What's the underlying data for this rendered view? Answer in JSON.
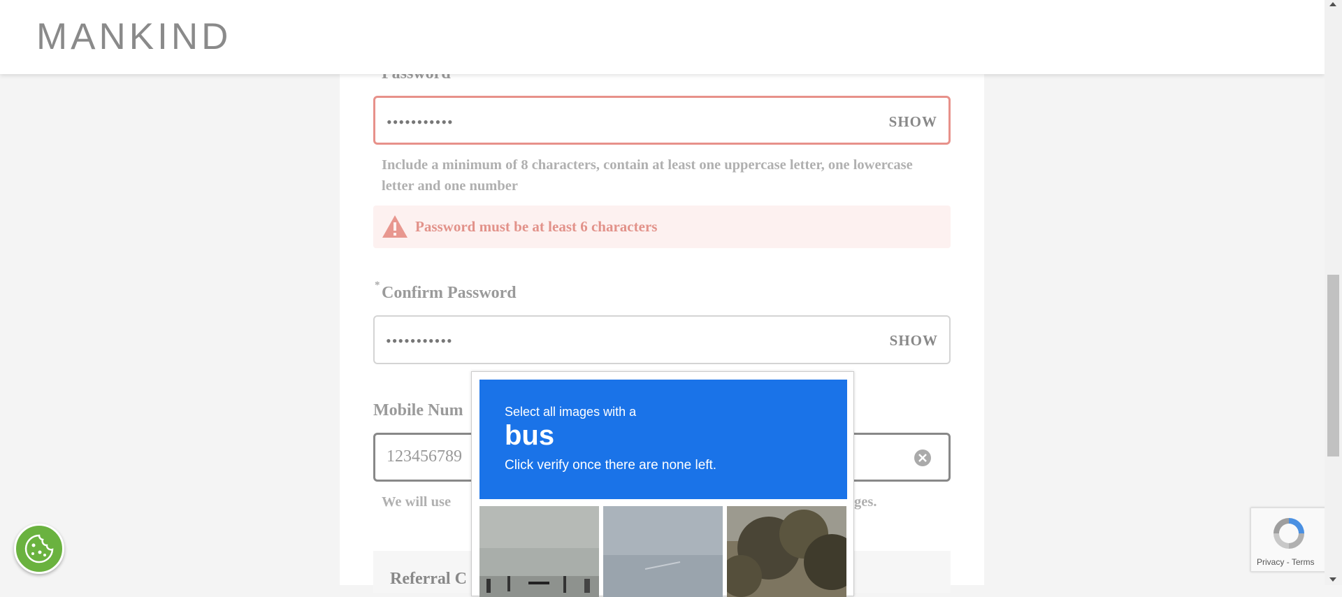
{
  "header": {
    "logo": "MANKIND"
  },
  "password": {
    "label": "Password",
    "masked_value": "•••••••••••",
    "show_label": "SHOW",
    "hint": "Include a minimum of 8 characters, contain at least one uppercase letter, one lowercase letter and one number",
    "error": "Password must be at least 6 characters"
  },
  "confirm_password": {
    "required_mark": "*",
    "label": "Confirm Password",
    "masked_value": "•••••••••••",
    "show_label": "SHOW"
  },
  "mobile": {
    "label_visible": "Mobile Num",
    "value_visible": "123456789",
    "hint_left": "We will use",
    "hint_right": "ges."
  },
  "referral": {
    "label_visible": "Referral C"
  },
  "captcha": {
    "line1": "Select all images with a",
    "target": "bus",
    "line3": "Click verify once there are none left.",
    "header_color": "#1a73e8"
  },
  "recaptcha_badge": {
    "privacy": "Privacy",
    "separator": "-",
    "terms": "Terms"
  },
  "colors": {
    "error_border": "#e7918a",
    "error_bg": "#fdf1f0",
    "cookie_button": "#6ab23f"
  }
}
